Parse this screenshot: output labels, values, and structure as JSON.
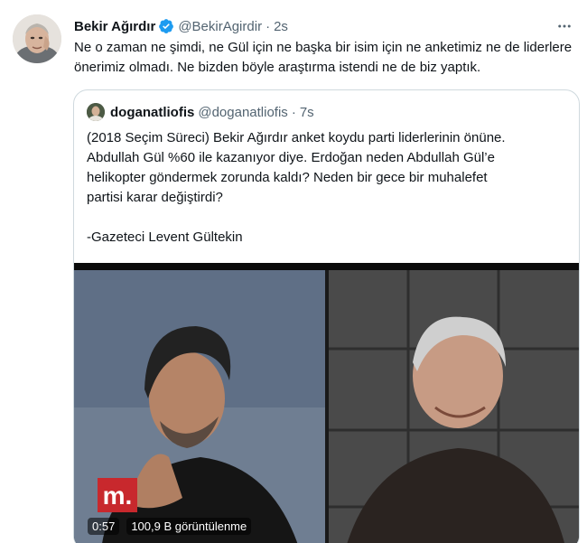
{
  "tweet": {
    "author_name": "Bekir Ağırdır",
    "author_handle": "@BekirAgirdir",
    "separator": "·",
    "time": "2s",
    "text": "Ne o zaman ne şimdi, ne Gül için ne başka bir isim için ne anketimiz ne de liderlere önerimiz olmadı. Ne bizden böyle araştırma istendi ne de biz yaptık."
  },
  "quoted": {
    "author_name": "doganatliofis",
    "author_handle": "@doganatliofis",
    "separator": "·",
    "time": "7s",
    "lines": [
      "(2018 Seçim Süreci) Bekir Ağırdır anket koydu parti liderlerinin önüne.",
      "Abdullah Gül %60 ile kazanıyor diye. Erdoğan neden Abdullah Gül’e",
      "helikopter göndermek zorunda kaldı? Neden bir gece bir muhalefet",
      "partisi karar değiştirdi?",
      "",
      "-Gazeteci Levent Gültekin"
    ],
    "video": {
      "channel_logo": "m.",
      "duration": "0:57",
      "views": "100,9 B görüntülenme"
    }
  },
  "icons": {
    "verified": "verified-badge-icon",
    "more": "more-horizontal-icon"
  },
  "colors": {
    "primary_text": "#0f1419",
    "secondary_text": "#536471",
    "verified_blue": "#1d9bf0",
    "border": "#cfd9de",
    "logo_red": "#c8282d"
  }
}
